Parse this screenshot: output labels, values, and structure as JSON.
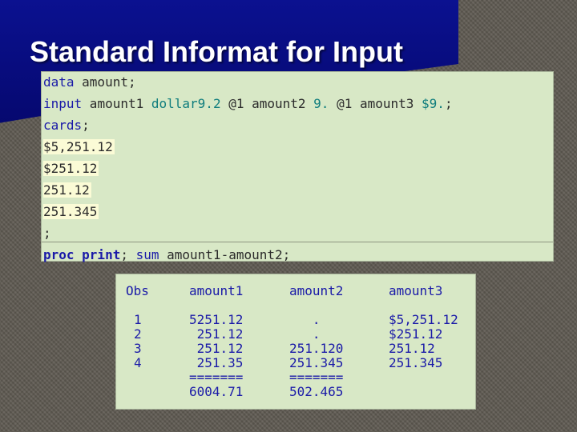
{
  "slide": {
    "title": "Standard Informat for Input"
  },
  "code": {
    "line1": {
      "kw": "data",
      "rest": " amount;"
    },
    "line2": {
      "kw": "input",
      "var1": " amount1 ",
      "fmt1": "dollar9.2",
      "ptr1": " @1 ",
      "var2": "amount2 ",
      "fmt2": "9.",
      "ptr2": " @1 ",
      "var3": "amount3 ",
      "fmt3": "$9.",
      "end": ";"
    },
    "line3": {
      "kw": "cards",
      "end": ";"
    },
    "data_lines": [
      "$5,251.12",
      "$251.12",
      "251.12",
      "251.345"
    ],
    "line8": ";",
    "line9": {
      "kw1": "proc print",
      "semi": ";",
      "kw2": " sum",
      "rest": " amount1-amount2;"
    }
  },
  "output": {
    "headers": [
      "Obs",
      "amount1",
      "amount2",
      "amount3"
    ],
    "obs": "1\n2\n3\n4",
    "amount1": "5251.12\n 251.12\n 251.12\n 251.35\n=======\n6004.71",
    "amount2": "   .\n   .\n251.120\n251.345\n=======\n502.465",
    "amount3": "$5,251.12\n$251.12\n251.12\n251.345"
  },
  "colors": {
    "keyword": "#1a1aa8",
    "format": "#0f7d7d",
    "panel": "#d8e8c6",
    "banner": "#0b1190"
  }
}
